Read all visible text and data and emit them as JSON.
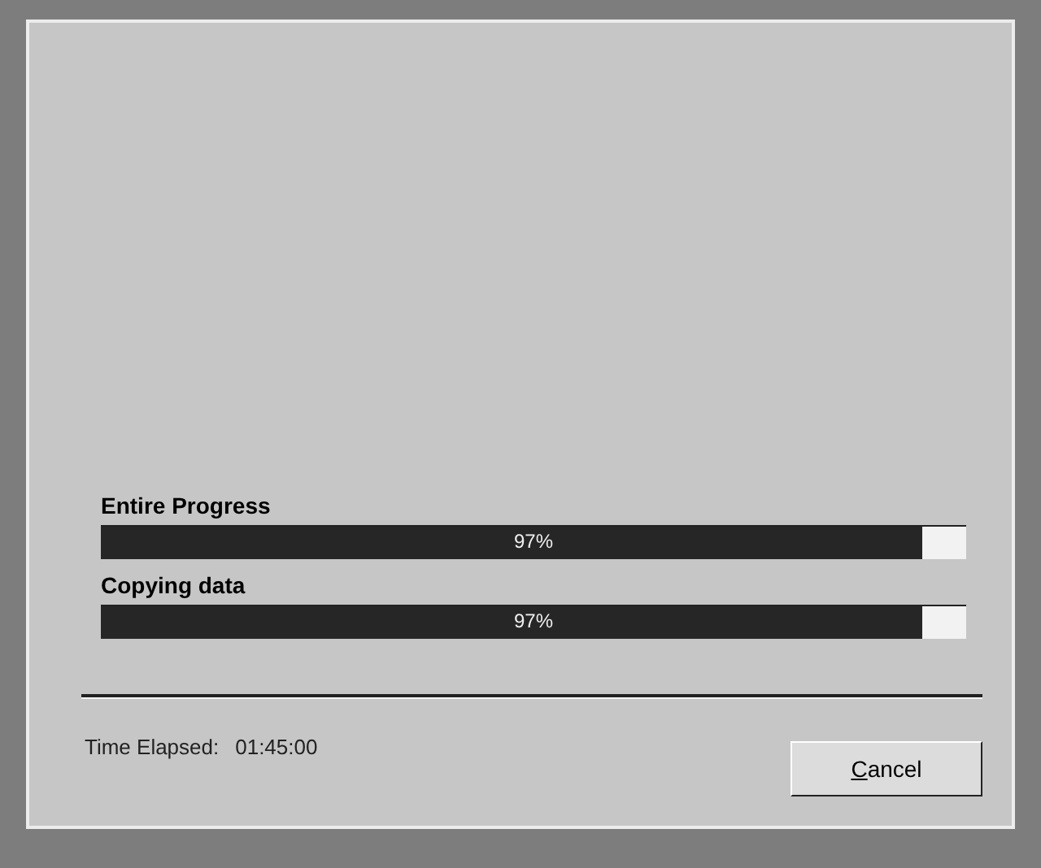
{
  "progress": [
    {
      "label": "Entire Progress",
      "level": 0.95,
      "reading": "97%"
    },
    {
      "label": "Copying data",
      "level": 0.95,
      "reading": "97%"
    }
  ],
  "status": {
    "label": "Time Elapsed:",
    "value": "01:45:00"
  },
  "buttons": [
    "Cancel"
  ]
}
